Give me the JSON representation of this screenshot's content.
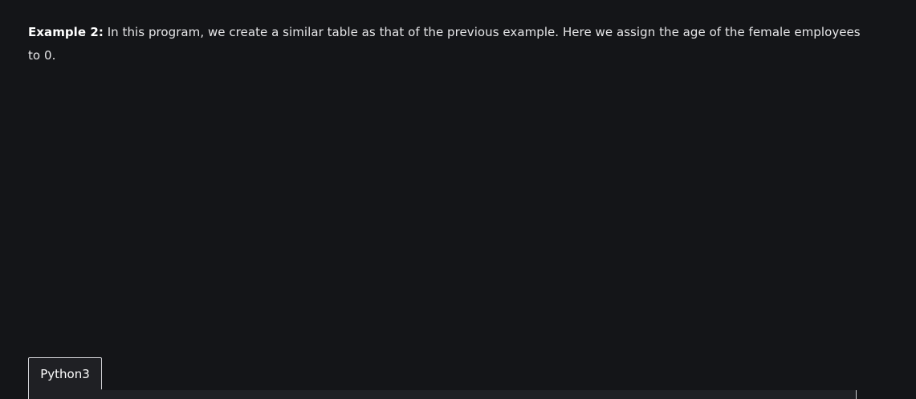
{
  "article": {
    "example_label": "Example 2:",
    "example_text": " In this program, we create a similar table as that of the previous example. Here we assign the age of the female employees to 0."
  },
  "code_block": {
    "tabs": [
      {
        "label": "Python3",
        "active": true
      }
    ]
  },
  "colors": {
    "background": "#141518",
    "code_background": "#1f2024",
    "border": "#d0d0d4",
    "text": "#e6e6e8"
  }
}
